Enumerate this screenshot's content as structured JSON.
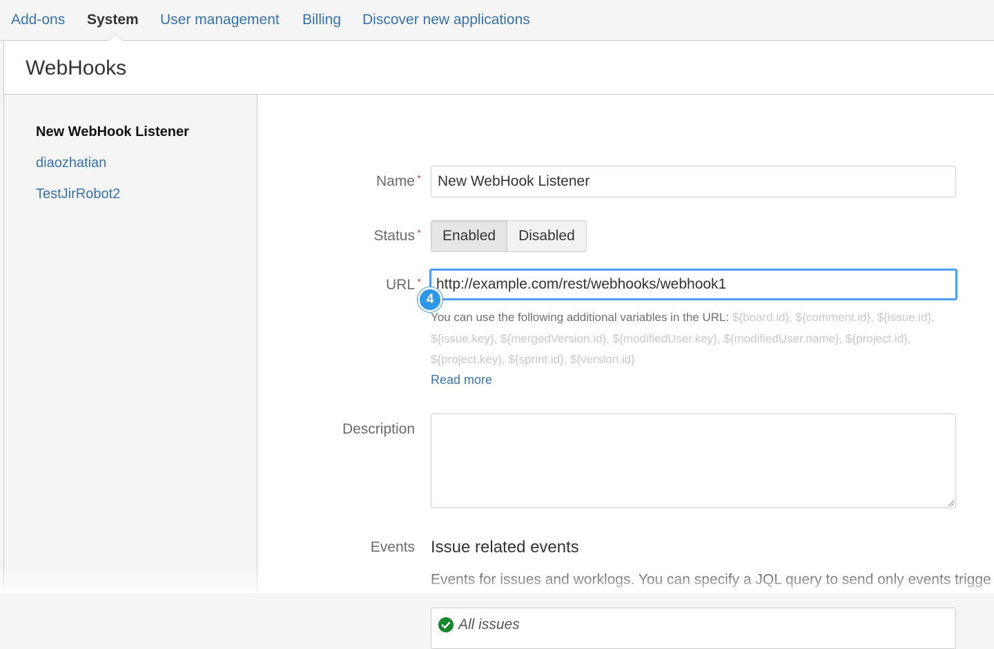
{
  "topnav": {
    "tabs": [
      {
        "label": "Add-ons"
      },
      {
        "label": "System"
      },
      {
        "label": "User management"
      },
      {
        "label": "Billing"
      },
      {
        "label": "Discover new applications"
      }
    ],
    "active_tab": "System"
  },
  "page": {
    "title": "WebHooks"
  },
  "sidebar": {
    "items": [
      {
        "label": "New WebHook Listener"
      },
      {
        "label": "diaozhatian"
      },
      {
        "label": "TestJirRobot2"
      }
    ],
    "active_item": "New WebHook Listener"
  },
  "form": {
    "required_mark": "*",
    "name": {
      "label": "Name",
      "value": "New WebHook Listener"
    },
    "status": {
      "label": "Status",
      "options": [
        "Enabled",
        "Disabled"
      ],
      "selected": "Enabled"
    },
    "url": {
      "label": "URL",
      "value": "http://example.com/rest/webhooks/webhook1",
      "step_badge": "4",
      "help_text": "You can use the following additional variables in the URL: ",
      "variables": "${board.id}, ${comment.id}, ${issue.id}, ${issue.key}, ${mergedVersion.id}, ${modifiedUser.key}, ${modifiedUser.name}, ${project.id}, ${project.key}, ${sprint.id}, ${version.id}",
      "read_more": "Read more"
    },
    "description": {
      "label": "Description",
      "value": ""
    },
    "events": {
      "label": "Events",
      "title": "Issue related events",
      "description": "Events for issues and worklogs. You can specify a JQL query to send only events trigge",
      "filter_label": "All issues"
    }
  },
  "colors": {
    "link": "#3572b0",
    "focus": "#4a9ff5",
    "badge": "#2d97e8",
    "required": "#d04437",
    "check": "#14892c"
  },
  "icons": {
    "check": "check-circle-icon",
    "resize": "resize-handle-icon"
  }
}
